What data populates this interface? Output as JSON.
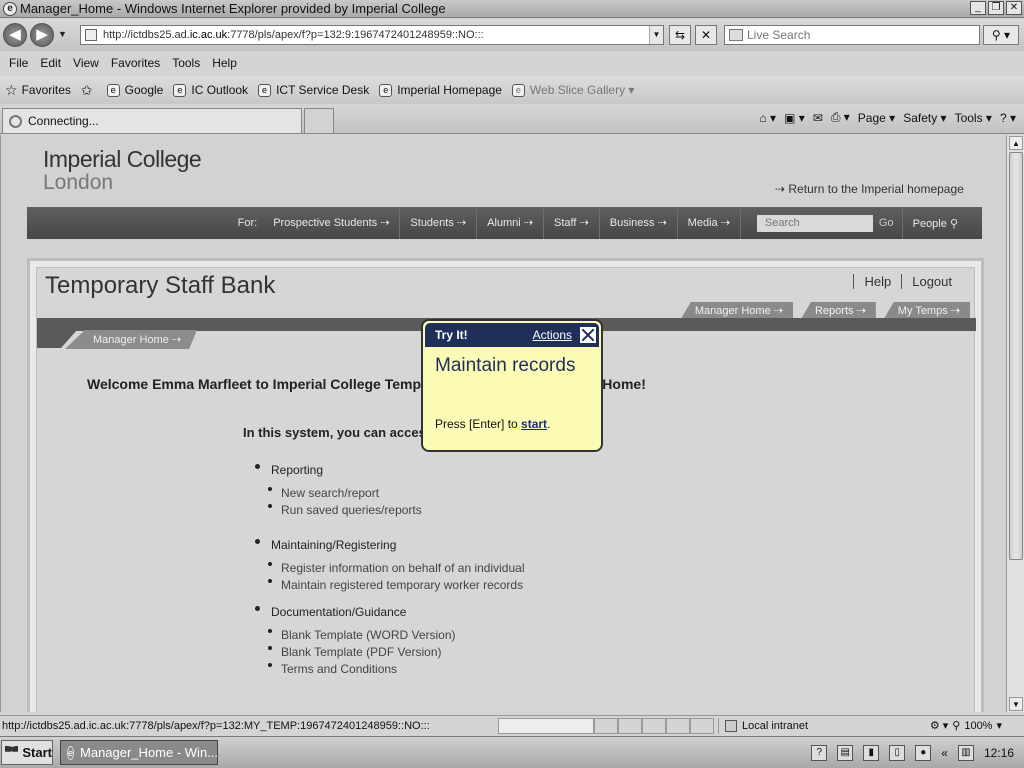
{
  "window": {
    "title": "Manager_Home - Windows Internet Explorer provided by Imperial College",
    "minimize": "_",
    "restore": "❐",
    "close": "✕"
  },
  "address_bar": {
    "url_prefix": "http://ictdbs25.ad.",
    "url_domain": "ic.ac.uk",
    "url_suffix": ":7778/pls/apex/f?p=132:9:1967472401248959::NO:::",
    "search_placeholder": "Live Search"
  },
  "menu": [
    "File",
    "Edit",
    "View",
    "Favorites",
    "Tools",
    "Help"
  ],
  "favorites_bar": {
    "label": "Favorites",
    "items": [
      "Google",
      "IC Outlook",
      "ICT Service Desk",
      "Imperial Homepage"
    ],
    "gallery": "Web Slice Gallery"
  },
  "tab": {
    "label": "Connecting..."
  },
  "command_bar": {
    "page": "Page",
    "safety": "Safety",
    "tools": "Tools",
    "help": "?"
  },
  "site": {
    "logo_line1": "Imperial College",
    "logo_line2": "London",
    "return_link": "Return to the Imperial homepage",
    "nav_for": "For:",
    "nav_items": [
      "Prospective Students",
      "Students",
      "Alumni",
      "Staff",
      "Business",
      "Media"
    ],
    "search_placeholder": "Search",
    "go": "Go",
    "people": "People"
  },
  "app": {
    "title": "Temporary Staff Bank",
    "help": "Help",
    "logout": "Logout",
    "tabs": [
      "Manager Home",
      "Reports",
      "My Temps"
    ],
    "subtab": "Manager Home",
    "welcome": "Welcome Emma Marfleet to Imperial College Temporary Staff Bank Managers Home!",
    "intro": "In this system, you can access:",
    "sections": [
      {
        "heading": "Reporting",
        "items": [
          "New search/report",
          "Run saved queries/reports"
        ]
      },
      {
        "heading": "Maintaining/Registering",
        "items": [
          "Register information on behalf of an individual",
          "Maintain registered temporary worker records"
        ]
      },
      {
        "heading": "Documentation/Guidance",
        "items": [
          "Blank Template (WORD Version)",
          "Blank Template (PDF Version)",
          "Terms and Conditions"
        ]
      }
    ]
  },
  "popup": {
    "header": "Try It!",
    "actions": "Actions",
    "title": "Maintain records",
    "body_prefix": "Press [Enter] to ",
    "start_link": "start",
    "body_suffix": "."
  },
  "status_bar": {
    "url": "http://ictdbs25.ad.ic.ac.uk:7778/pls/apex/f?p=132:MY_TEMP:1967472401248959::NO:::",
    "zone": "Local intranet",
    "zoom": "100%"
  },
  "taskbar": {
    "start": "Start",
    "task": "Manager_Home - Win...",
    "time": "12:16"
  }
}
